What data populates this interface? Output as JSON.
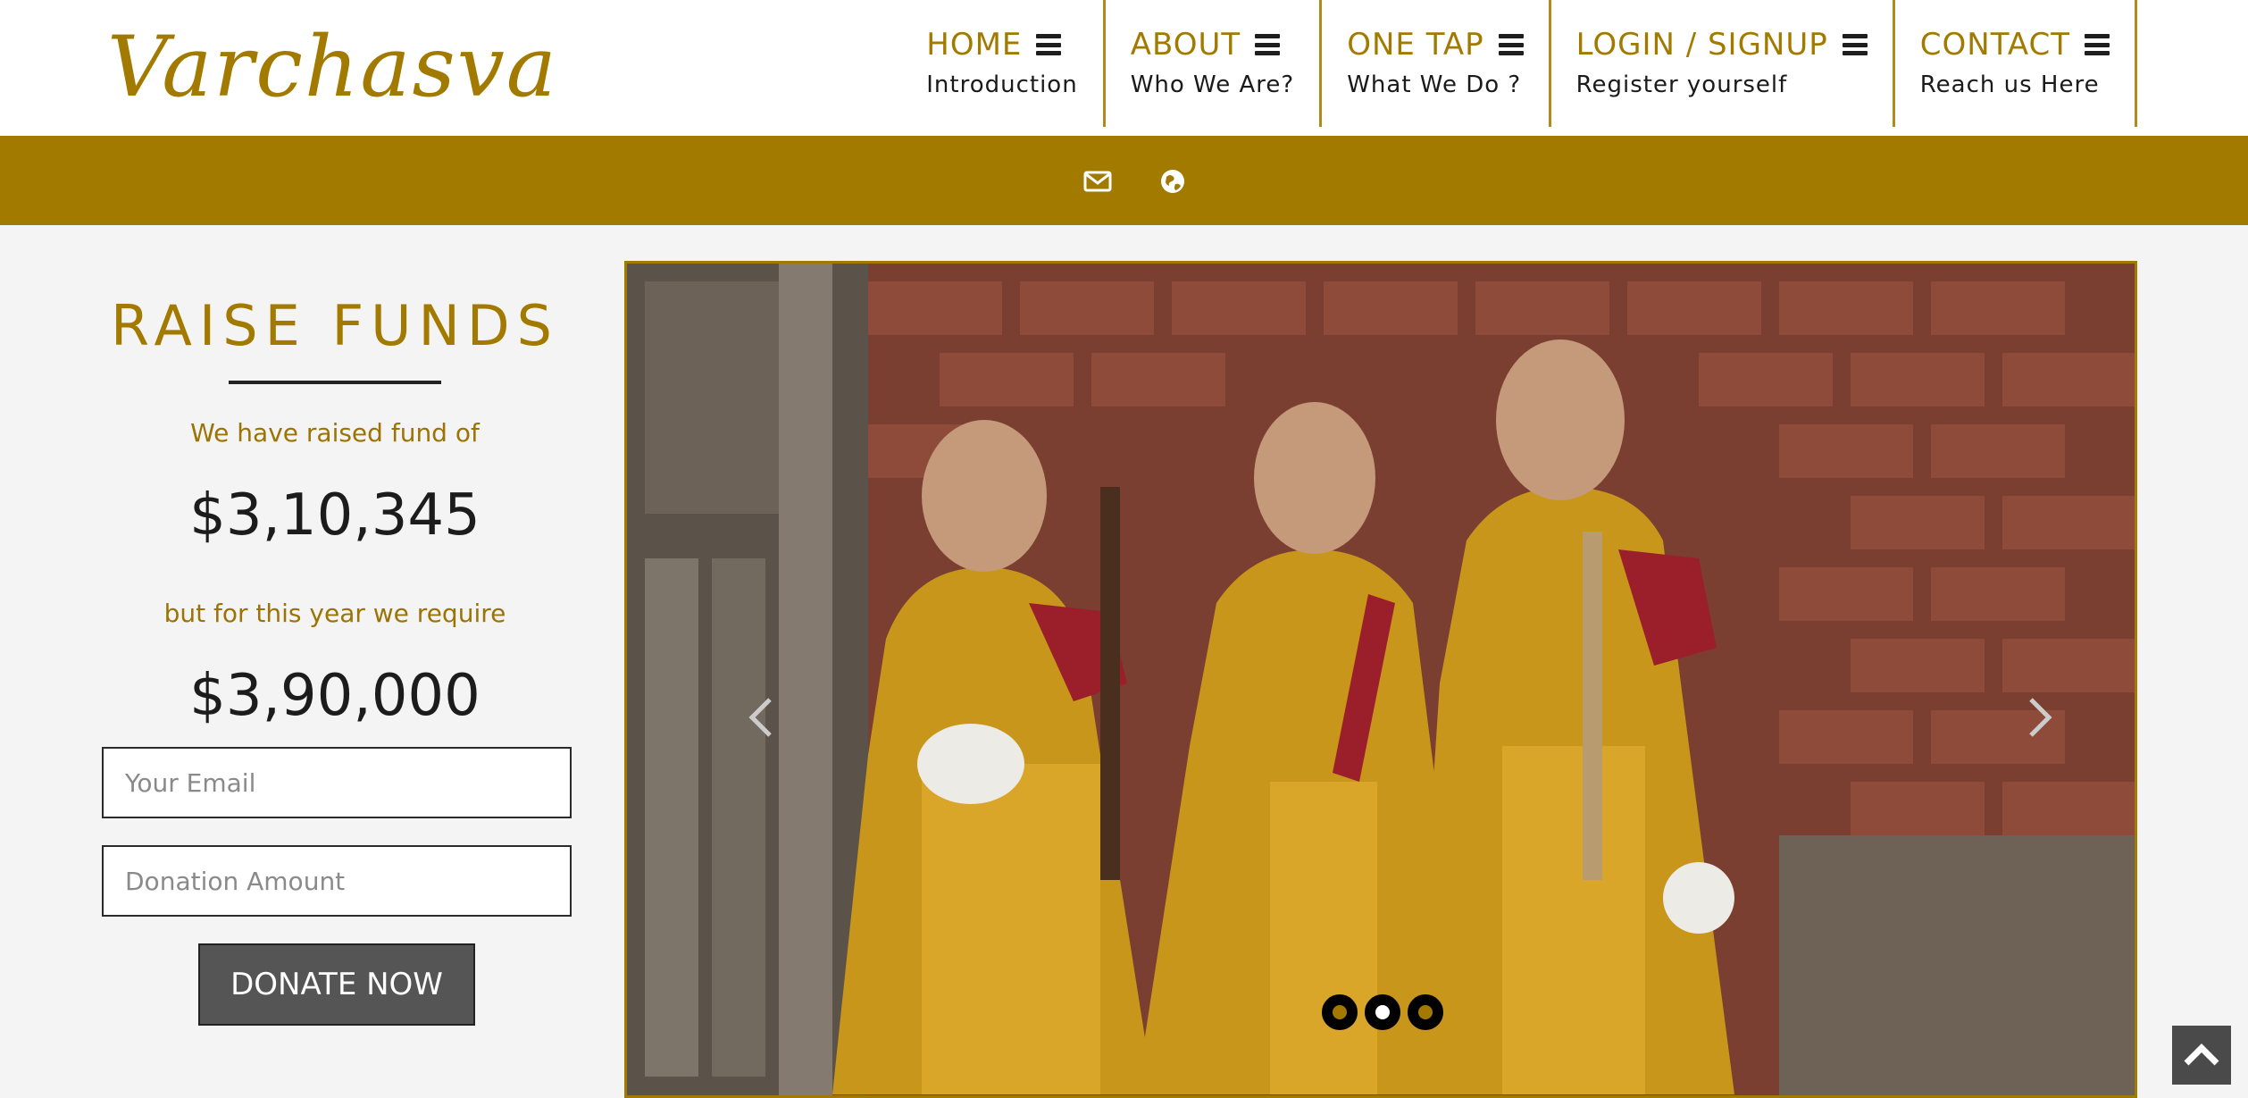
{
  "brand": {
    "logo_text": "Varchasva"
  },
  "nav": [
    {
      "title": "HOME",
      "subtitle": "Introduction"
    },
    {
      "title": "ABOUT",
      "subtitle": "Who We Are?"
    },
    {
      "title": "ONE TAP",
      "subtitle": "What We Do ?"
    },
    {
      "title": "LOGIN / SIGNUP",
      "subtitle": "Register yourself"
    },
    {
      "title": "CONTACT",
      "subtitle": "Reach us Here"
    }
  ],
  "topbar": {
    "icons": [
      "envelope-icon",
      "globe-icon"
    ]
  },
  "fundraise": {
    "title": "RAISE FUNDS",
    "raised_label": "We have raised fund of",
    "raised_amount": "$3,10,345",
    "required_label": "but for this year we require",
    "required_amount": "$3,90,000",
    "email_placeholder": "Your Email",
    "amount_placeholder": "Donation Amount",
    "donate_label": "DONATE NOW"
  },
  "slider": {
    "slide_count": 3,
    "active_slide": 2
  },
  "colors": {
    "accent": "#a37a00",
    "button": "#555555",
    "background": "#f4f4f4"
  }
}
